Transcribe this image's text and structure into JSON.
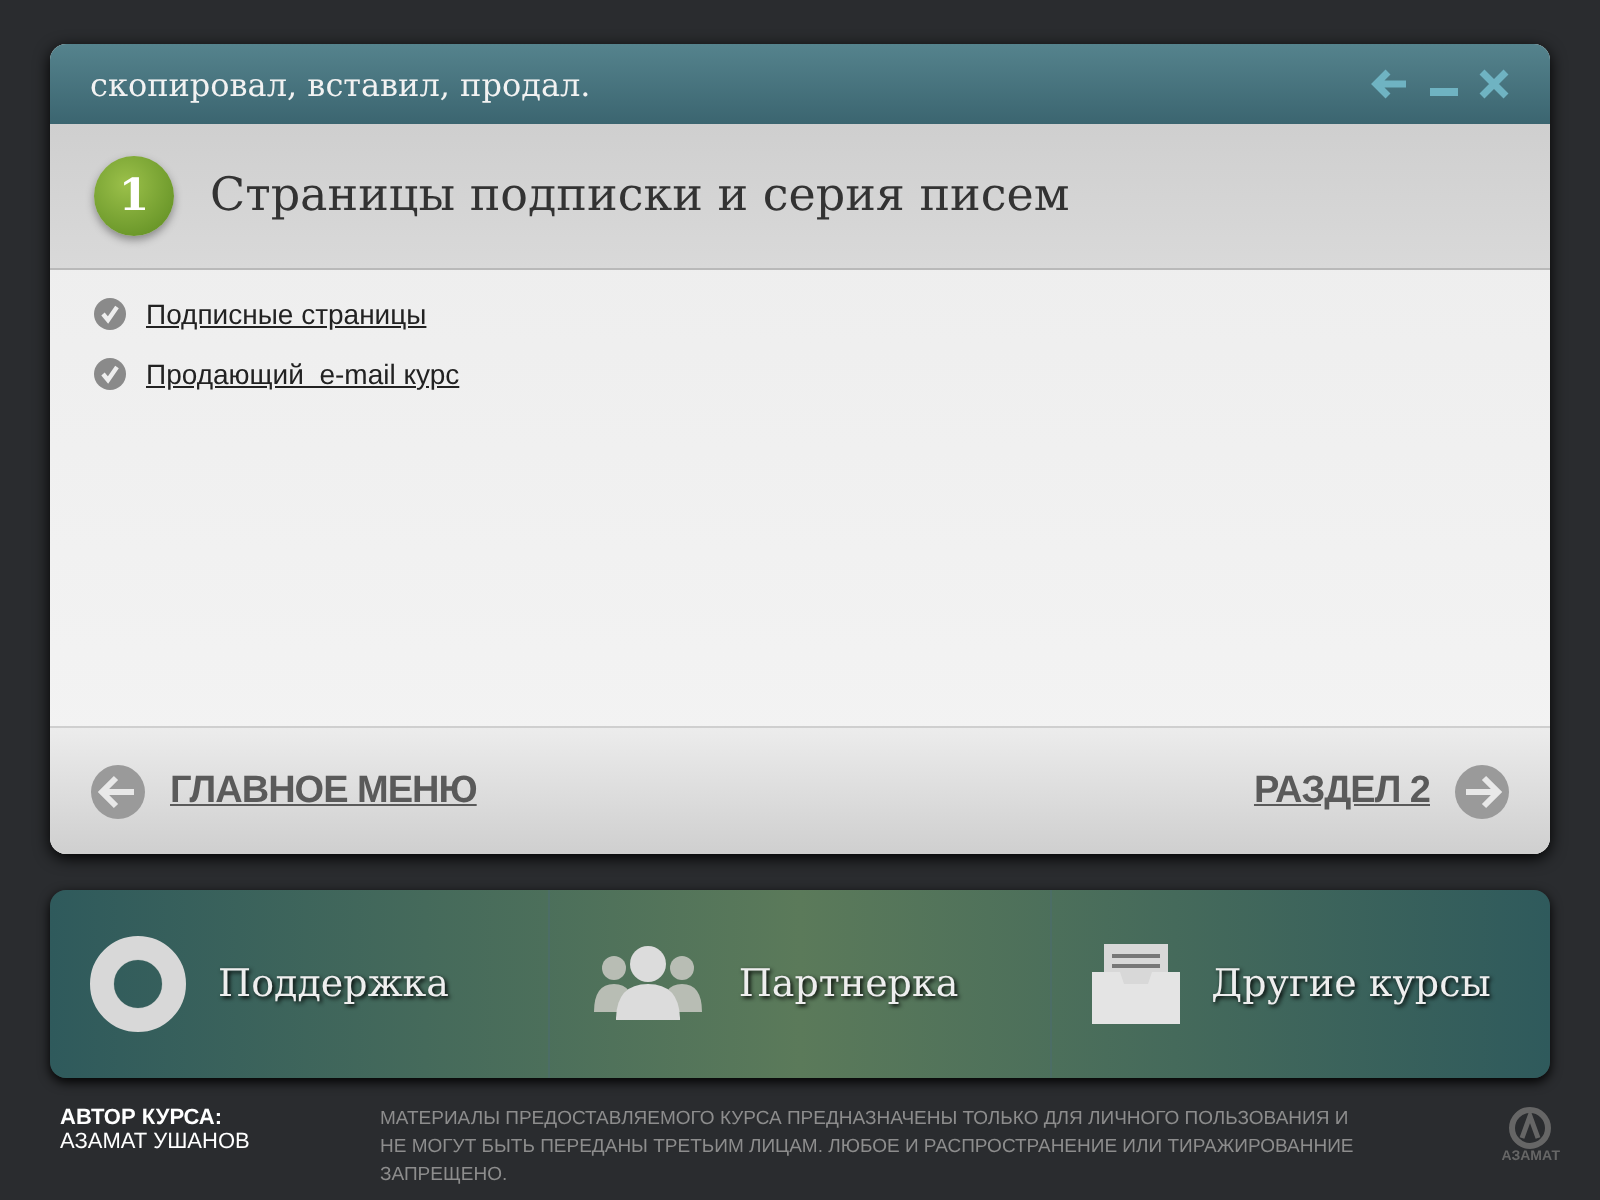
{
  "window": {
    "title": "скопировал, вставил, продал."
  },
  "section": {
    "number": "1",
    "title": "Страницы подписки и серия писем"
  },
  "links": [
    {
      "label": "Подписные страницы"
    },
    {
      "label": "Продающий  e-mail курс"
    }
  ],
  "nav": {
    "back": "ГЛАВНОЕ МЕНЮ",
    "next": "РАЗДЕЛ 2"
  },
  "bottom_menu": [
    {
      "kind": "support",
      "label": "Поддержка"
    },
    {
      "kind": "partners",
      "label": "Партнерка"
    },
    {
      "kind": "courses",
      "label": "Другие курсы"
    }
  ],
  "footer": {
    "author_label": "АВТОР КУРСА:",
    "author_name": "АЗАМАТ УШАНОВ",
    "notice": "МАТЕРИАЛЫ ПРЕДОСТАВЛЯЕМОГО КУРСА ПРЕДНАЗНАЧЕНЫ ТОЛЬКО ДЛЯ ЛИЧНОГО ПОЛЬЗОВАНИЯ И НЕ МОГУТ БЫТЬ ПЕРЕДАНЫ ТРЕТЬИМ ЛИЦАМ. ЛЮБОЕ И РАСПРОСТРАНЕНИЕ ИЛИ ТИРАЖИРОВАННИЕ ЗАПРЕЩЕНО.",
    "logo_text": "АЗАМАТ"
  }
}
